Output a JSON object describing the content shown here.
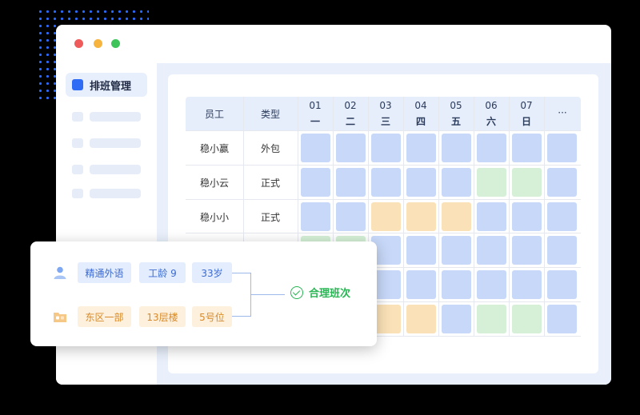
{
  "sidebar": {
    "active_item": "排班管理"
  },
  "table": {
    "headers": {
      "employee": "员工",
      "type": "类型",
      "more": "···"
    },
    "days": [
      {
        "num": "01",
        "weekday": "一"
      },
      {
        "num": "02",
        "weekday": "二"
      },
      {
        "num": "03",
        "weekday": "三"
      },
      {
        "num": "04",
        "weekday": "四"
      },
      {
        "num": "05",
        "weekday": "五"
      },
      {
        "num": "06",
        "weekday": "六"
      },
      {
        "num": "07",
        "weekday": "日"
      }
    ],
    "rows": [
      {
        "name": "稳小赢",
        "type": "外包"
      },
      {
        "name": "稳小云",
        "type": "正式"
      },
      {
        "name": "稳小小",
        "type": "正式"
      }
    ]
  },
  "popup": {
    "row1_tags": [
      "精通外语",
      "工龄 9",
      "33岁"
    ],
    "row2_tags": [
      "东区一部",
      "13层楼",
      "5号位"
    ],
    "result": "合理班次"
  },
  "colors": {
    "accent": "#2f6cf6",
    "success": "#28b553",
    "shift_blue": "#c7d8f8",
    "shift_green": "#d5f0d7",
    "shift_orange": "#fbe1b7"
  }
}
